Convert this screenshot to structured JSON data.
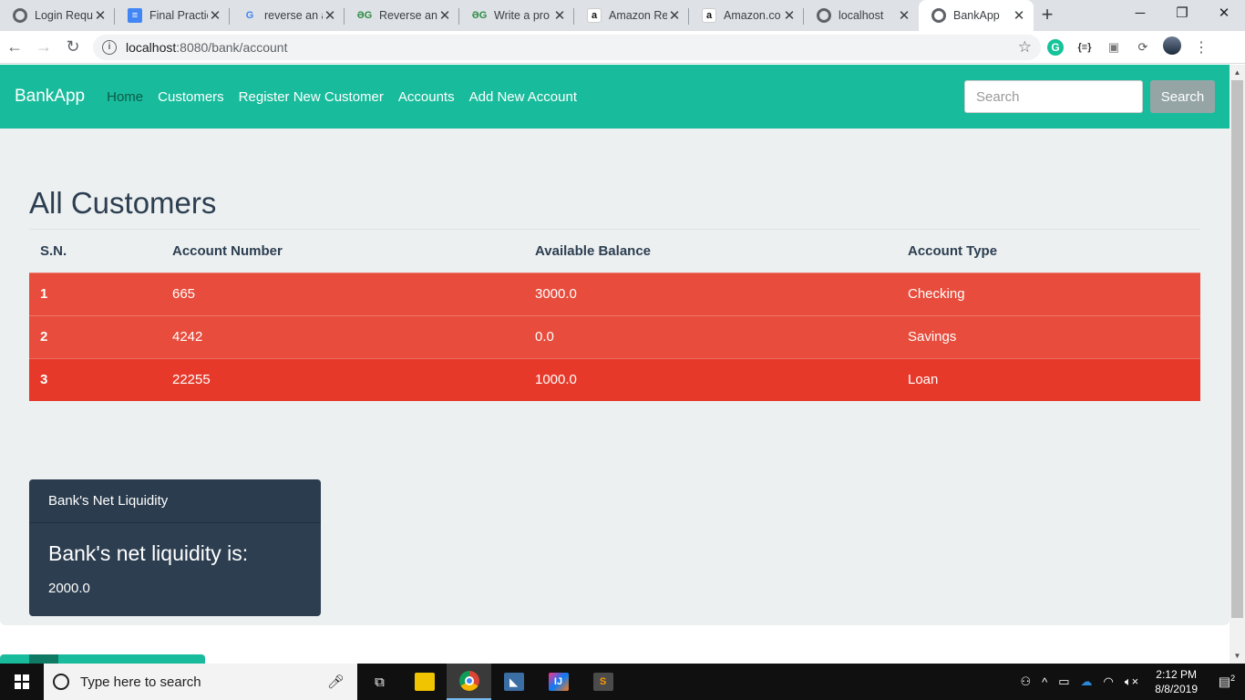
{
  "browser": {
    "tabs": [
      {
        "title": "Login Requ",
        "icon": "globe-icon"
      },
      {
        "title": "Final Practic",
        "icon": "docs-icon"
      },
      {
        "title": "reverse an a",
        "icon": "google-icon"
      },
      {
        "title": "Reverse an",
        "icon": "geeksforgeeks-icon"
      },
      {
        "title": "Write a pro",
        "icon": "geeksforgeeks-icon"
      },
      {
        "title": "Amazon Re",
        "icon": "amazon-icon"
      },
      {
        "title": "Amazon.co",
        "icon": "amazon-icon"
      },
      {
        "title": "localhost",
        "icon": "globe-icon"
      },
      {
        "title": "BankApp",
        "icon": "globe-icon",
        "active": true
      }
    ],
    "url_host": "localhost",
    "url_path": ":8080/bank/account"
  },
  "navbar": {
    "brand": "BankApp",
    "links": [
      "Home",
      "Customers",
      "Register New Customer",
      "Accounts",
      "Add New Account"
    ],
    "search_placeholder": "Search",
    "search_button": "Search"
  },
  "main": {
    "title": "All Customers",
    "columns": [
      "S.N.",
      "Account Number",
      "Available Balance",
      "Account Type"
    ],
    "rows": [
      [
        "1",
        "665",
        "3000.0",
        "Checking"
      ],
      [
        "2",
        "4242",
        "0.0",
        "Savings"
      ],
      [
        "3",
        "22255",
        "1000.0",
        "Loan"
      ]
    ]
  },
  "card": {
    "header": "Bank's Net Liquidity",
    "title": "Bank's net liquidity is:",
    "value": "2000.0"
  },
  "taskbar": {
    "search_placeholder": "Type here to search",
    "time": "2:12 PM",
    "date": "8/8/2019",
    "notification_count": "2"
  },
  "colors": {
    "primary": "#18bc9c",
    "danger": "#e74c3c",
    "dark": "#2c3e50",
    "light_bg": "#ecf0f1"
  }
}
